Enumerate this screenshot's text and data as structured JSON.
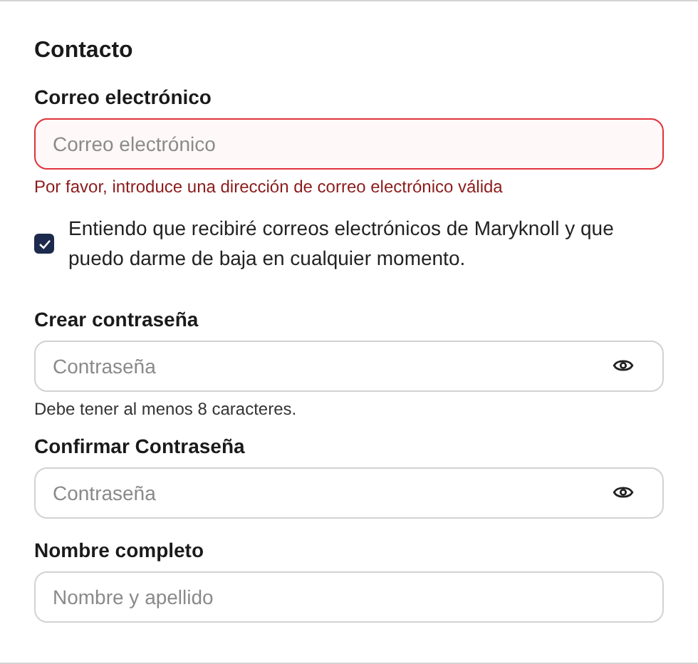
{
  "section": {
    "title": "Contacto"
  },
  "items": [
    {
      "kind": "field",
      "label": "Correo electrónico",
      "placeholder": "Correo electrónico",
      "invalid": true,
      "error": "Por favor, introduce una dirección de correo electrónico válida",
      "reveal_toggle": false
    },
    {
      "kind": "checkbox",
      "label": "Entiendo que recibiré correos electrónicos de Maryknoll y que puedo darme de baja en cualquier momento.",
      "checked": true
    },
    {
      "kind": "field",
      "label": "Crear contraseña",
      "placeholder": "Contraseña",
      "invalid": false,
      "hint": "Debe tener al menos 8 caracteres.",
      "reveal_toggle": true
    },
    {
      "kind": "field",
      "label": "Confirmar Contraseña",
      "placeholder": "Contraseña",
      "invalid": false,
      "reveal_toggle": true
    },
    {
      "kind": "field",
      "label": "Nombre completo",
      "placeholder": "Nombre y apellido",
      "invalid": false,
      "reveal_toggle": false
    }
  ]
}
